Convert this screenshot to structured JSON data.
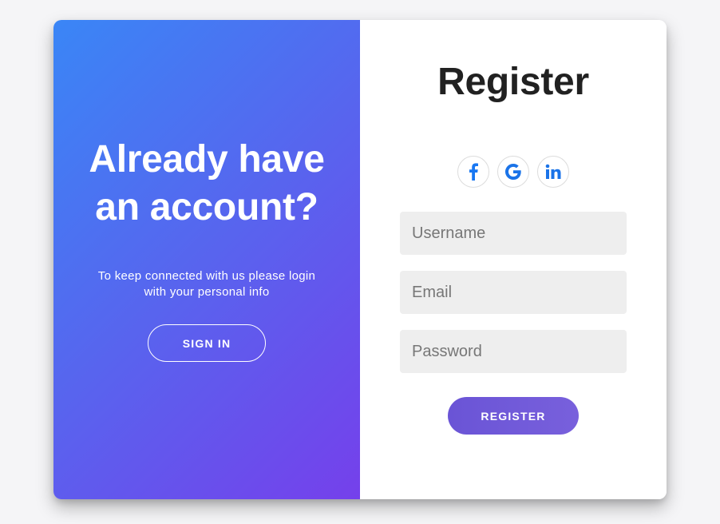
{
  "overlay": {
    "heading": "Already have an account?",
    "message": "To keep connected with us please login with your personal info",
    "sign_in_label": "SIGN IN"
  },
  "register": {
    "title": "Register",
    "socials": [
      {
        "name": "facebook-icon",
        "color": "#1877f2"
      },
      {
        "name": "google-icon",
        "color": "#1a73e8"
      },
      {
        "name": "linkedin-icon",
        "color": "#1a73e8"
      }
    ],
    "fields": {
      "username": {
        "placeholder": "Username",
        "value": ""
      },
      "email": {
        "placeholder": "Email",
        "value": ""
      },
      "password": {
        "placeholder": "Password",
        "value": ""
      }
    },
    "submit_label": "REGISTER"
  },
  "colors": {
    "gradient_start": "#3a86f6",
    "gradient_end": "#7540eb",
    "accent": "#6a54d6",
    "input_bg": "#eeeeee"
  }
}
